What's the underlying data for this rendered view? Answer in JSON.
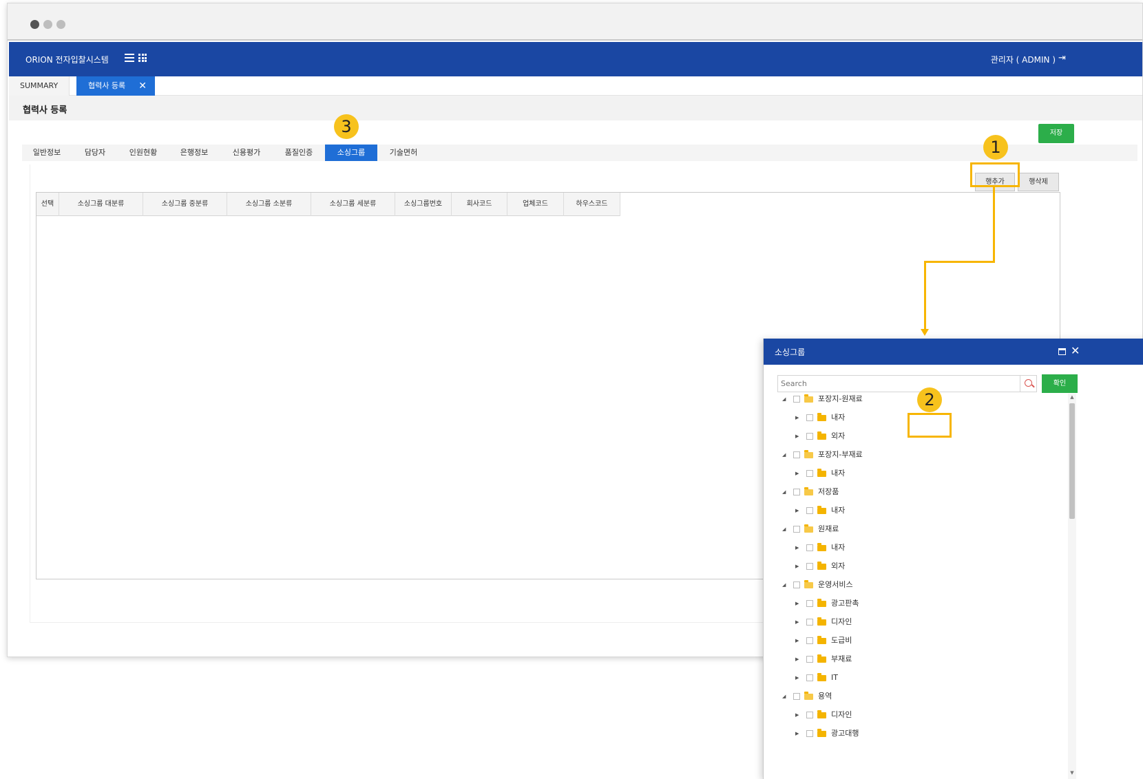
{
  "app": {
    "title": "ORION 전자입찰시스템",
    "user": "관리자 ( ADMIN )"
  },
  "tabs": {
    "summary": "SUMMARY",
    "active": "협력사 등록"
  },
  "page": {
    "title": "협력사 등록",
    "save_label": "저장"
  },
  "subtabs": [
    "일반정보",
    "담당자",
    "인원현황",
    "은행정보",
    "신용평가",
    "품질인증",
    "소싱그룹",
    "기술면허"
  ],
  "actions": {
    "add_row": "행추가",
    "delete_row": "행삭제"
  },
  "grid": {
    "columns": [
      "선택",
      "소싱그룹 대분류",
      "소싱그룹 중분류",
      "소싱그룹 소분류",
      "소싱그룹 세분류",
      "소싱그룹번호",
      "회사코드",
      "업체코드",
      "하우스코드"
    ]
  },
  "badges": {
    "one": "1",
    "two": "2",
    "three": "3"
  },
  "modal": {
    "title": "소싱그룹",
    "search_placeholder": "Search",
    "confirm_label": "확인",
    "tree": [
      {
        "label": "포장지-원재료",
        "children": [
          "내자",
          "외자"
        ]
      },
      {
        "label": "포장지-부재료",
        "children": [
          "내자"
        ]
      },
      {
        "label": "저장품",
        "children": [
          "내자"
        ]
      },
      {
        "label": "원재료",
        "children": [
          "내자",
          "외자"
        ]
      },
      {
        "label": "운영서비스",
        "children": [
          "광고판촉",
          "디자인",
          "도급비",
          "부재료",
          "IT"
        ]
      },
      {
        "label": "용역",
        "children": [
          "디자인",
          "광고대행"
        ]
      }
    ]
  },
  "colors": {
    "header_blue": "#1a47a3",
    "tab_blue": "#1f6ed6",
    "save_green": "#2cae4a",
    "highlight_yellow": "#f7b500"
  }
}
